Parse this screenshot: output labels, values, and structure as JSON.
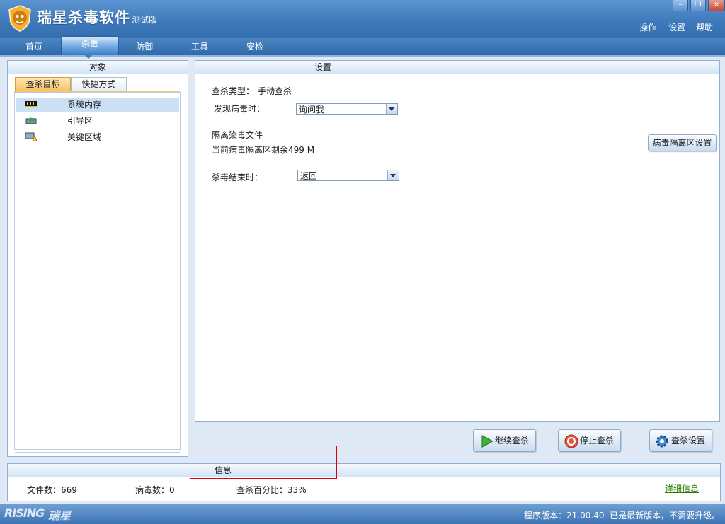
{
  "window": {
    "title": "瑞星杀毒软件",
    "edition": "测试版",
    "controls": {
      "minimize": "–",
      "restore": "❐",
      "close": "×"
    },
    "menu": [
      "操作",
      "设置",
      "帮助"
    ]
  },
  "tabs": [
    "首页",
    "杀毒",
    "防御",
    "工具",
    "安检"
  ],
  "target_panel": {
    "title": "对象",
    "subtabs": [
      "查杀目标",
      "快捷方式"
    ],
    "items": [
      {
        "label": "系统内存",
        "icon": "memory-chip-icon"
      },
      {
        "label": "引导区",
        "icon": "boot-sector-icon"
      },
      {
        "label": "关键区域",
        "icon": "critical-area-icon"
      }
    ]
  },
  "settings_panel": {
    "title": "设置",
    "scan_type_label": "查杀类型：",
    "scan_type_value": "手动查杀",
    "virus_found_label": "发现病毒时：",
    "virus_found_value": "询问我",
    "quarantine_title": "隔离染毒文件",
    "quarantine_remaining": "当前病毒隔离区剩余499 M",
    "quarantine_button": "病毒隔离区设置",
    "scan_end_label": "杀毒结束时：",
    "scan_end_value": "返回"
  },
  "actions": {
    "continue": "继续查杀",
    "stop": "停止查杀",
    "settings": "查杀设置"
  },
  "info_panel": {
    "title": "信息",
    "files_label": "文件数：",
    "files_value": "669",
    "virus_label": "病毒数：",
    "virus_value": "0",
    "percent_label": "查杀百分比：",
    "percent_value": "33%",
    "details_link": "详细信息"
  },
  "statusbar": {
    "brand_en": "RISING",
    "brand_cn": "瑞星",
    "version_label": "程序版本：",
    "version_value": "21.00.40",
    "update_status": "已是最新版本，不需要升级。"
  },
  "colors": {
    "accent": "#3d78bb",
    "link": "#2b7a00",
    "highlight_box": "#d9000f"
  }
}
